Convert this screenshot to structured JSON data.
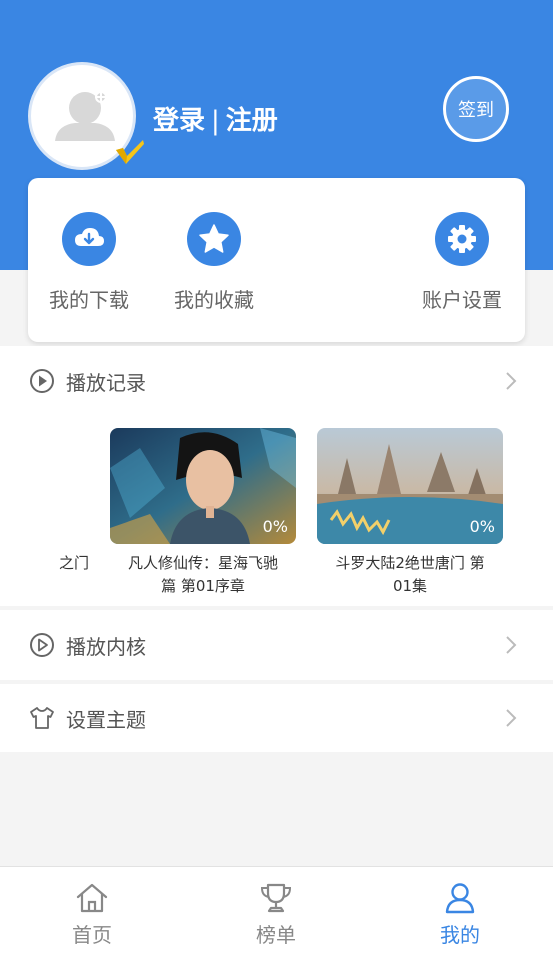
{
  "header": {
    "login_label": "登录",
    "separator": "|",
    "register_label": "注册",
    "signin_label": "签到",
    "brand_color": "#3a86e3"
  },
  "quick_actions": [
    {
      "label": "我的下载",
      "icon": "cloud-download-icon"
    },
    {
      "label": "我的收藏",
      "icon": "star-icon"
    },
    {
      "label": "账户设置",
      "icon": "gear-icon"
    }
  ],
  "play_history": {
    "title": "播放记录",
    "items": [
      {
        "title": "之门",
        "progress": ""
      },
      {
        "title": "凡人修仙传：星海飞驰篇 第01序章",
        "progress": "0%"
      },
      {
        "title": "斗罗大陆2绝世唐门 第01集",
        "progress": "0%"
      }
    ]
  },
  "player_core": {
    "title": "播放内核"
  },
  "theme": {
    "title": "设置主题"
  },
  "tabbar": {
    "tabs": [
      {
        "label": "首页",
        "icon": "home-icon",
        "active": false
      },
      {
        "label": "榜单",
        "icon": "trophy-icon",
        "active": false
      },
      {
        "label": "我的",
        "icon": "user-icon",
        "active": true
      }
    ]
  }
}
